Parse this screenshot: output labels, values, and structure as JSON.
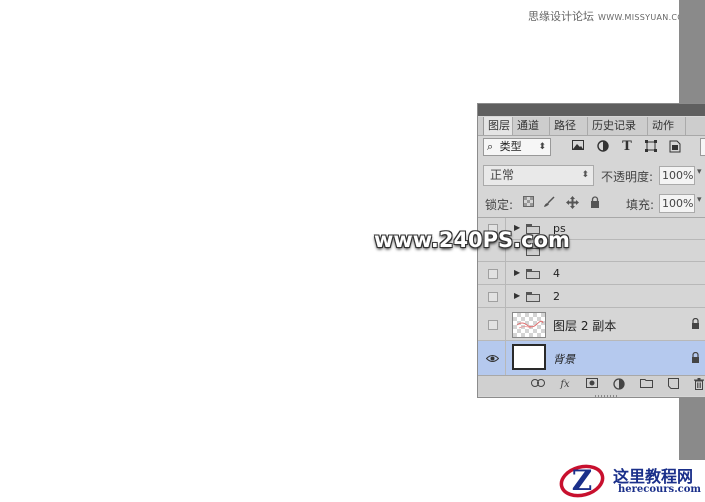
{
  "watermark_top": {
    "text": "思缘设计论坛",
    "url": "WWW.MISSYUAN.COM"
  },
  "watermark_mid": "www.240PS.com",
  "panel": {
    "tabs": [
      "图层",
      "通道",
      "路径",
      "历史记录",
      "动作"
    ],
    "active_tab": "图层",
    "filter": {
      "label": "类型",
      "search_glyph": "⌕"
    },
    "filter_icons": [
      "image-filter-icon",
      "adjustment-filter-icon",
      "type-filter-icon",
      "shape-filter-icon",
      "smart-object-filter-icon"
    ],
    "blend_mode": "正常",
    "opacity_label": "不透明度:",
    "opacity_value": "100%",
    "lock_label": "锁定:",
    "fill_label": "填充:",
    "fill_value": "100%",
    "layers": [
      {
        "name": "ps",
        "type": "group",
        "visible": false
      },
      {
        "name": "4",
        "type": "group",
        "visible": false
      },
      {
        "name": "2",
        "type": "group",
        "visible": false
      },
      {
        "name": "图层 2 副本",
        "type": "layer",
        "visible": false,
        "locked": true
      },
      {
        "name": "背景",
        "type": "background",
        "visible": true,
        "locked": true,
        "selected": true
      }
    ],
    "bottom_icons": [
      "link-icon",
      "fx-icon",
      "mask-icon",
      "adjustment-icon",
      "folder-icon",
      "new-layer-icon",
      "trash-icon"
    ],
    "fx_text": "fx"
  },
  "logo": {
    "title": "这里教程网",
    "subtitle": "herecours.com",
    "mark": "Z"
  },
  "colors": {
    "selected_row": "#b5c9ee",
    "panel_bg": "#d6d6d6",
    "logo_blue": "#1a2f8a",
    "logo_red": "#c8102e"
  }
}
